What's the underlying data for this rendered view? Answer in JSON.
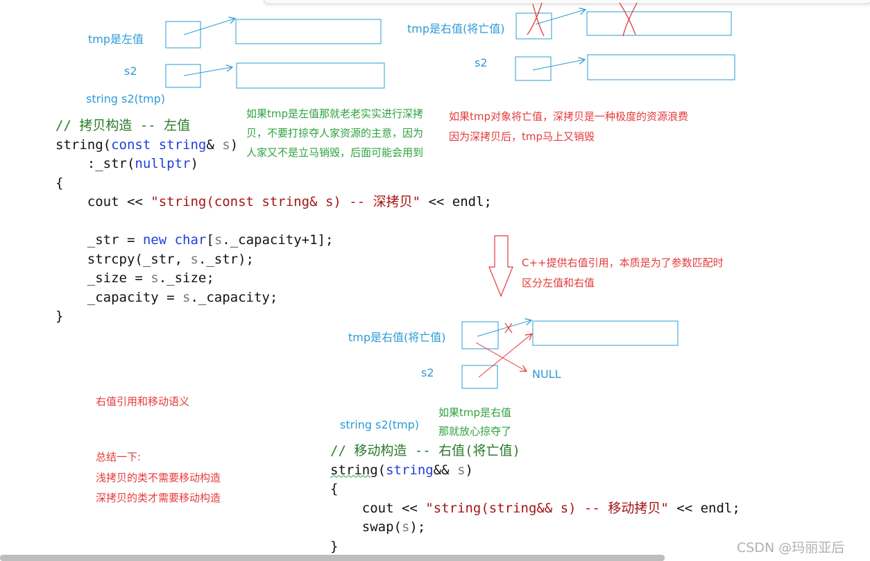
{
  "labels": {
    "tmp_lvalue": "tmp是左值",
    "s2_a": "s2",
    "string_s2_tmp_a": "string  s2(tmp)",
    "tmp_rvalue_a": "tmp是右值(将亡值)",
    "s2_b": "s2",
    "tmp_rvalue_b": "tmp是右值(将亡值)",
    "s2_c": "s2",
    "null_label": "NULL",
    "string_s2_tmp_b": "string  s2(tmp)"
  },
  "notes": {
    "green_lvalue_1": "如果tmp是左值那就老老实实进行深拷",
    "green_lvalue_2": "贝，不要打掠夺人家资源的主意，因为",
    "green_lvalue_3": "人家又不是立马销毁，后面可能会用到",
    "red_waste_1": "如果tmp对象将亡值，深拷贝是一种极度的资源浪费",
    "red_waste_2": "因为深拷贝后，tmp马上又销毁",
    "red_cpp_1": "C++提供右值引用，本质是为了参数匹配时",
    "red_cpp_2": "区分左值和右值",
    "green_rvalue_1": "如果tmp是右值",
    "green_rvalue_2": "那就放心掠夺了",
    "red_move_title": "右值引用和移动语义",
    "red_summary_1": "总结一下:",
    "red_summary_2": "浅拷贝的类不需要移动构造",
    "red_summary_3": "深拷贝的类才需要移动构造"
  },
  "copy_code": {
    "comment": "// 拷贝构造 -- 左值",
    "sig_string": "string(",
    "sig_const": "const",
    "sig_type": " string",
    "sig_amp": "& ",
    "sig_param": "s",
    "sig_close": ")",
    "init_prefix": "    :_str(",
    "init_null": "nullptr",
    "init_close": ")",
    "open_brace": "{",
    "cout_a": "    cout << ",
    "cout_str": "\"string(const string& s) -- 深拷贝\"",
    "cout_b": " << endl;",
    "alloc_a": "    _str = ",
    "alloc_new": "new",
    "alloc_char": " char",
    "alloc_b": "[",
    "alloc_s": "s",
    "alloc_c": "._capacity+1];",
    "strcpy_a": "    strcpy(_str, ",
    "strcpy_s": "s",
    "strcpy_b": "._str);",
    "size_a": "    _size = ",
    "size_s": "s",
    "size_b": "._size;",
    "cap_a": "    _capacity = ",
    "cap_s": "s",
    "cap_b": "._capacity;",
    "close_brace": "}"
  },
  "move_code": {
    "comment": "// 移动构造 -- 右值(将亡值)",
    "sig_string": "string",
    "sig_open": "(",
    "sig_type": "string",
    "sig_amp": "&& ",
    "sig_param": "s",
    "sig_close": ")",
    "open_brace": "{",
    "cout_a": "    cout << ",
    "cout_str": "\"string(string&& s) -- 移动拷贝\"",
    "cout_b": " << endl;",
    "swap_a": "    swap(",
    "swap_s": "s",
    "swap_b": ");",
    "close_brace": "}"
  },
  "watermark": "CSDN @玛丽亚后",
  "colors": {
    "diagram_blue": "#2b9bd6",
    "note_green": "#2ea13e",
    "note_red": "#e53a3a",
    "keyword_blue": "#1f3fd8",
    "string_red": "#a31515"
  }
}
